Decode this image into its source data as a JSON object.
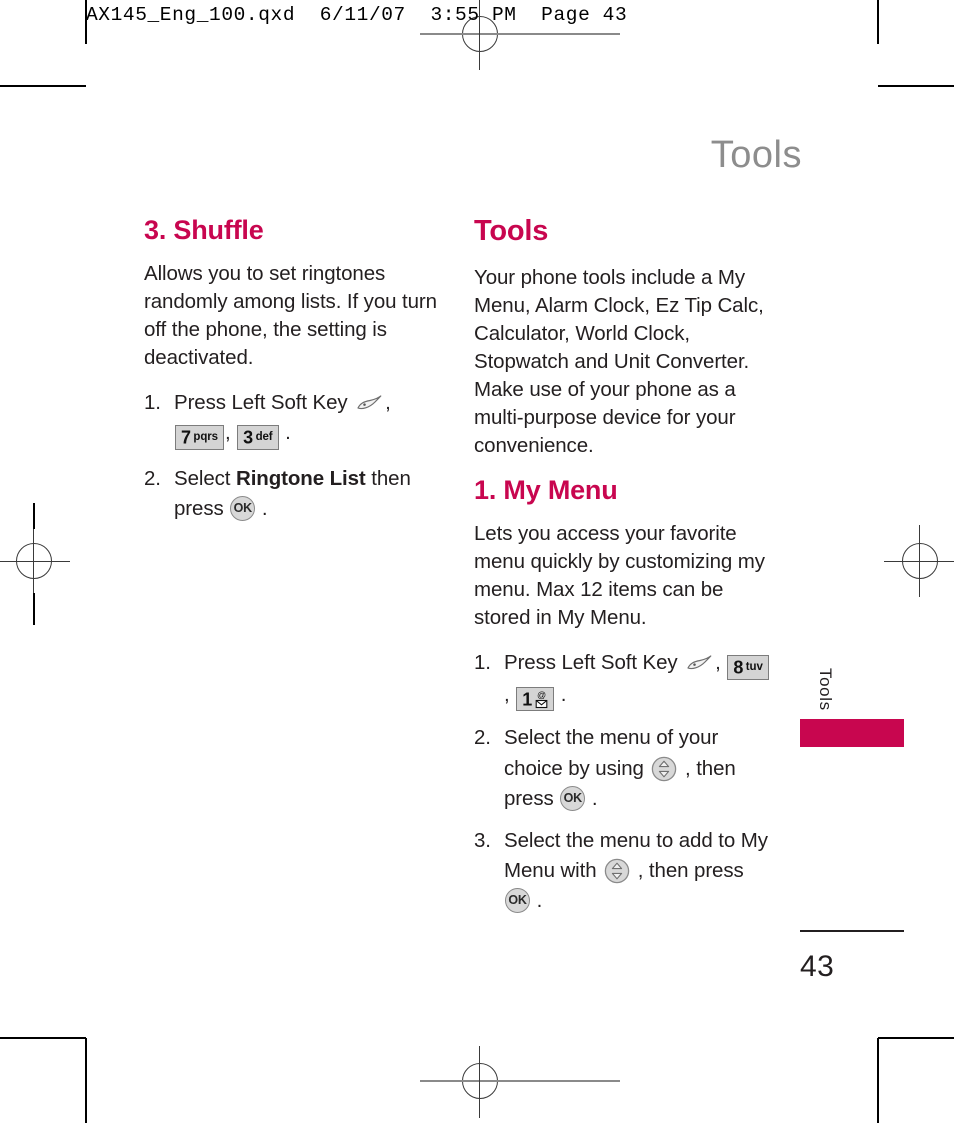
{
  "prepress": {
    "header_line": "AX145_Eng_100.qxd  6/11/07  3:55 PM  Page 43"
  },
  "page": {
    "running_head": "Tools",
    "side_tab_label": "Tools",
    "folio": "43"
  },
  "left_column": {
    "heading": "3. Shuffle",
    "intro": "Allows you to set ringtones randomly among lists. If you turn off the phone, the setting is deactivated.",
    "steps": [
      {
        "num": "1.",
        "parts": [
          {
            "type": "text",
            "value": "Press Left Soft Key "
          },
          {
            "type": "softkey",
            "name": "left-soft-key"
          },
          {
            "type": "text",
            "value": ", "
          },
          {
            "type": "keycap",
            "digit": "7",
            "letters": "pqrs"
          },
          {
            "type": "text",
            "value": ", "
          },
          {
            "type": "keycap",
            "digit": "3",
            "letters": "def"
          },
          {
            "type": "text",
            "value": " ."
          }
        ]
      },
      {
        "num": "2.",
        "parts": [
          {
            "type": "text",
            "value": "Select "
          },
          {
            "type": "bold",
            "value": "Ringtone List"
          },
          {
            "type": "text",
            "value": " then press "
          },
          {
            "type": "okkey",
            "label": "OK"
          },
          {
            "type": "text",
            "value": " ."
          }
        ]
      }
    ]
  },
  "right_column": {
    "heading": "Tools",
    "intro": "Your phone tools include a My Menu, Alarm Clock,  Ez Tip Calc, Calculator, World Clock, Stopwatch and Unit Converter. Make use of your phone as a multi-purpose device for your convenience.",
    "subheading": "1. My Menu",
    "sub_intro": "Lets you access your favorite menu quickly by customizing my menu. Max 12 items can be stored in My Menu.",
    "steps": [
      {
        "num": "1.",
        "parts": [
          {
            "type": "text",
            "value": "Press Left Soft Key "
          },
          {
            "type": "softkey",
            "name": "left-soft-key"
          },
          {
            "type": "text",
            "value": ", "
          },
          {
            "type": "keycap",
            "digit": "8",
            "letters": "tuv"
          },
          {
            "type": "text",
            "value": ", "
          },
          {
            "type": "keycap",
            "digit": "1",
            "letters": "@-envelope"
          },
          {
            "type": "text",
            "value": " ."
          }
        ]
      },
      {
        "num": "2.",
        "parts": [
          {
            "type": "text",
            "value": "Select the menu of your choice by using "
          },
          {
            "type": "navkey",
            "name": "up-down-navigation-key"
          },
          {
            "type": "text",
            "value": " , then press "
          },
          {
            "type": "okkey",
            "label": "OK"
          },
          {
            "type": "text",
            "value": " ."
          }
        ]
      },
      {
        "num": "3.",
        "parts": [
          {
            "type": "text",
            "value": "Select the menu to add to My Menu with "
          },
          {
            "type": "navkey",
            "name": "up-down-navigation-key"
          },
          {
            "type": "text",
            "value": " , then press "
          },
          {
            "type": "okkey",
            "label": "OK"
          },
          {
            "type": "text",
            "value": " ."
          }
        ]
      }
    ]
  },
  "colors": {
    "accent": "#c8064f",
    "running_head": "#8d8d8d",
    "body_text": "#231f20",
    "keycap_fill": "#d4d4d4"
  }
}
